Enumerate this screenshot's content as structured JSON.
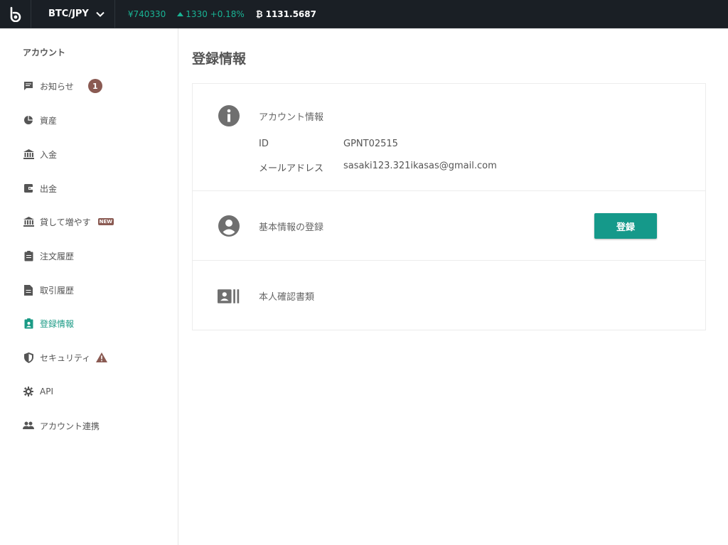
{
  "topbar": {
    "pair": "BTC/JPY",
    "price": "¥740330",
    "change": "1330 +0.18%",
    "volume": "1131.5687"
  },
  "sidebar": {
    "heading": "アカウント",
    "items": [
      {
        "label": "お知らせ",
        "icon": "message-icon",
        "badge": "1"
      },
      {
        "label": "資産",
        "icon": "pie-chart-icon"
      },
      {
        "label": "入金",
        "icon": "bank-icon"
      },
      {
        "label": "出金",
        "icon": "wallet-icon"
      },
      {
        "label": "貸して増やす",
        "icon": "bank-icon",
        "tag": "NEW"
      },
      {
        "label": "注文履歴",
        "icon": "clipboard-icon"
      },
      {
        "label": "取引履歴",
        "icon": "document-icon"
      },
      {
        "label": "登録情報",
        "icon": "account-box-icon",
        "active": true
      },
      {
        "label": "セキュリティ",
        "icon": "shield-icon",
        "warning": true
      },
      {
        "label": "API",
        "icon": "gear-icon"
      },
      {
        "label": "アカウント連携",
        "icon": "people-icon"
      }
    ]
  },
  "main": {
    "title": "登録情報",
    "account_section": {
      "title": "アカウント情報",
      "id_label": "ID",
      "id_value": "GPNT02515",
      "email_label": "メールアドレス",
      "email_value": "sasaki123.321ikasas@gmail.com"
    },
    "basic_section": {
      "title": "基本情報の登録",
      "button": "登録"
    },
    "identity_section": {
      "title": "本人確認書類"
    }
  },
  "colors": {
    "accent": "#15998a",
    "topbar_bg": "#1a1f25",
    "badge": "#8a5a52"
  }
}
